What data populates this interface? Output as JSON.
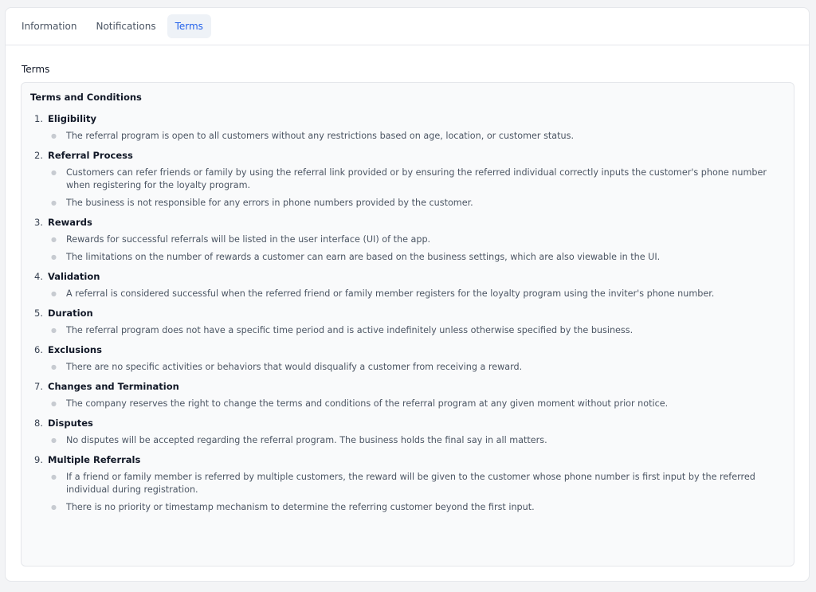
{
  "tabs": [
    {
      "label": "Information"
    },
    {
      "label": "Notifications"
    },
    {
      "label": "Terms",
      "active": true
    }
  ],
  "section_label": "Terms",
  "terms": {
    "title": "Terms and Conditions",
    "items": [
      {
        "num": "1.",
        "title": "Eligibility",
        "points": [
          "The referral program is open to all customers without any restrictions based on age, location, or customer status."
        ]
      },
      {
        "num": "2.",
        "title": "Referral Process",
        "points": [
          "Customers can refer friends or family by using the referral link provided or by ensuring the referred individual correctly inputs the customer's phone number when registering for the loyalty program.",
          "The business is not responsible for any errors in phone numbers provided by the customer."
        ]
      },
      {
        "num": "3.",
        "title": "Rewards",
        "points": [
          "Rewards for successful referrals will be listed in the user interface (UI) of the app.",
          "The limitations on the number of rewards a customer can earn are based on the business settings, which are also viewable in the UI."
        ]
      },
      {
        "num": "4.",
        "title": "Validation",
        "points": [
          "A referral is considered successful when the referred friend or family member registers for the loyalty program using the inviter's phone number."
        ]
      },
      {
        "num": "5.",
        "title": "Duration",
        "points": [
          "The referral program does not have a specific time period and is active indefinitely unless otherwise specified by the business."
        ]
      },
      {
        "num": "6.",
        "title": "Exclusions",
        "points": [
          "There are no specific activities or behaviors that would disqualify a customer from receiving a reward."
        ]
      },
      {
        "num": "7.",
        "title": "Changes and Termination",
        "points": [
          "The company reserves the right to change the terms and conditions of the referral program at any given moment without prior notice."
        ]
      },
      {
        "num": "8.",
        "title": "Disputes",
        "points": [
          "No disputes will be accepted regarding the referral program. The business holds the final say in all matters."
        ]
      },
      {
        "num": "9.",
        "title": "Multiple Referrals",
        "points": [
          "If a friend or family member is referred by multiple customers, the reward will be given to the customer whose phone number is first input by the referred individual during registration.",
          "There is no priority or timestamp mechanism to determine the referring customer beyond the first input."
        ]
      }
    ]
  }
}
